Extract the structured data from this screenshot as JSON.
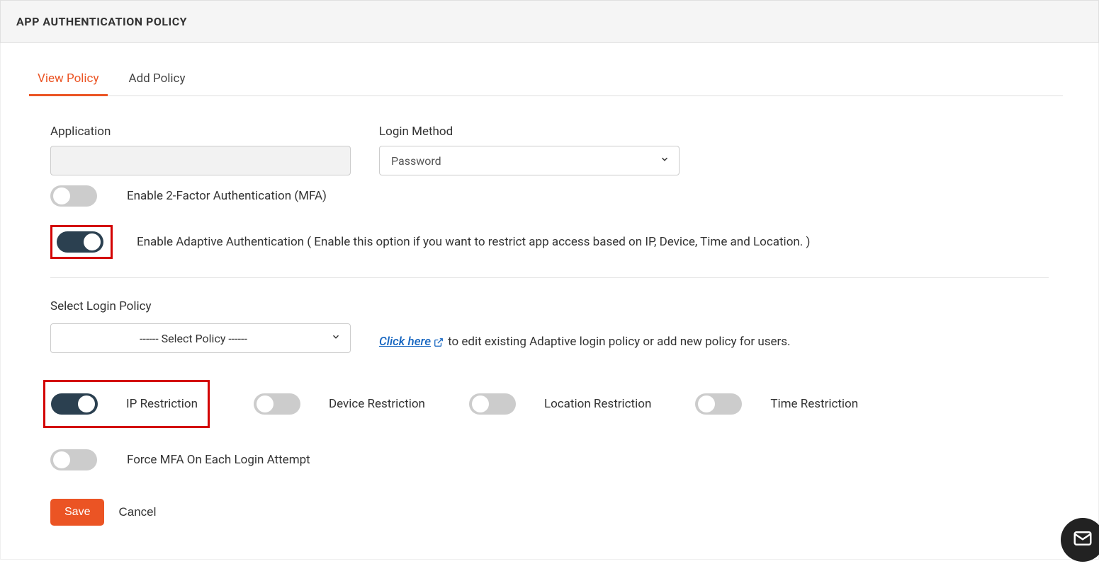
{
  "header": {
    "title": "APP AUTHENTICATION POLICY"
  },
  "tabs": {
    "view": "View Policy",
    "add": "Add Policy"
  },
  "fields": {
    "application_label": "Application",
    "application_value": "",
    "login_method_label": "Login Method",
    "login_method_value": "Password",
    "mfa_label": "Enable 2-Factor Authentication (MFA)",
    "adaptive_label": "Enable Adaptive Authentication ( Enable this option if you want to restrict app access based on IP, Device, Time and Location. )",
    "select_policy_label": "Select Login Policy",
    "select_policy_value": "------ Select Policy ------",
    "helper_link": "Click here",
    "helper_text": " to edit existing Adaptive login policy or add new policy for users.",
    "ip_restriction": "IP Restriction",
    "device_restriction": "Device Restriction",
    "location_restriction": "Location Restriction",
    "time_restriction": "Time Restriction",
    "force_mfa": "Force MFA On Each Login Attempt"
  },
  "buttons": {
    "save": "Save",
    "cancel": "Cancel"
  }
}
